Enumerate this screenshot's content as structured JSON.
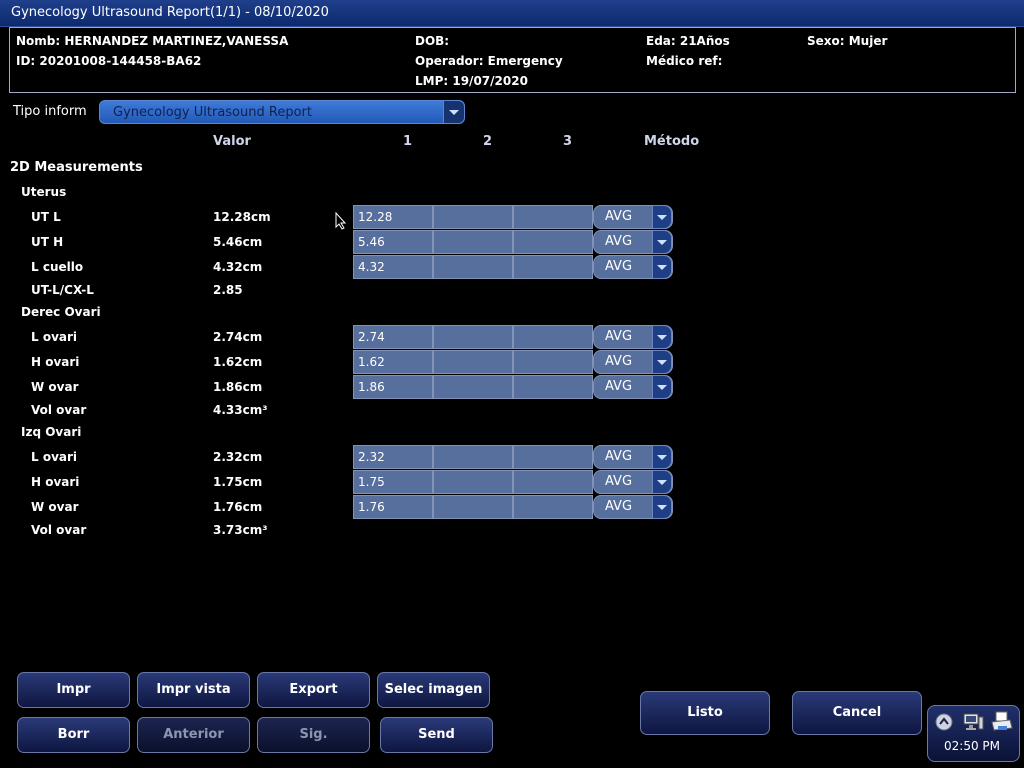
{
  "title": "Gynecology Ultrasound Report(1/1) - 08/10/2020",
  "patient": {
    "name": "Nomb: HERNANDEZ MARTINEZ,VANESSA",
    "id": "ID: 20201008-144458-BA62",
    "dob": "DOB:",
    "operator": "Operador: Emergency",
    "lmp": "LMP: 19/07/2020",
    "age": "Eda: 21Años",
    "ref_doctor": "Médico ref:",
    "sex": "Sexo: Mujer"
  },
  "report_type": {
    "label": "Tipo inform",
    "value": "Gynecology Ultrasound Report"
  },
  "columns": {
    "value": "Valor",
    "c1": "1",
    "c2": "2",
    "c3": "3",
    "method": "Método"
  },
  "section": "2D Measurements",
  "groups": {
    "uterus": {
      "name": "Uterus",
      "ut_l": {
        "label": "UT L",
        "value": "12.28cm",
        "m1": "12.28",
        "method": "AVG"
      },
      "ut_h": {
        "label": "UT H",
        "value": "5.46cm",
        "m1": "5.46",
        "method": "AVG"
      },
      "l_cuello": {
        "label": "L cuello",
        "value": "4.32cm",
        "m1": "4.32",
        "method": "AVG"
      },
      "ratio": {
        "label": "UT-L/CX-L",
        "value": "2.85"
      }
    },
    "right_ovary": {
      "name": "Derec Ovari",
      "l": {
        "label": "L ovari",
        "value": "2.74cm",
        "m1": "2.74",
        "method": "AVG"
      },
      "h": {
        "label": "H ovari",
        "value": "1.62cm",
        "m1": "1.62",
        "method": "AVG"
      },
      "w": {
        "label": "W ovar",
        "value": "1.86cm",
        "m1": "1.86",
        "method": "AVG"
      },
      "vol": {
        "label": "Vol ovar",
        "value": "4.33cm³"
      }
    },
    "left_ovary": {
      "name": "Izq Ovari",
      "l": {
        "label": "L ovari",
        "value": "2.32cm",
        "m1": "2.32",
        "method": "AVG"
      },
      "h": {
        "label": "H ovari",
        "value": "1.75cm",
        "m1": "1.75",
        "method": "AVG"
      },
      "w": {
        "label": "W ovar",
        "value": "1.76cm",
        "m1": "1.76",
        "method": "AVG"
      },
      "vol": {
        "label": "Vol ovar",
        "value": "3.73cm³"
      }
    }
  },
  "buttons": {
    "print": "Impr",
    "print_view": "Impr vista",
    "export": "Export",
    "select_image": "Selec imagen",
    "delete": "Borr",
    "previous": "Anterior",
    "next": "Sig.",
    "send": "Send",
    "done": "Listo",
    "cancel": "Cancel"
  },
  "tray": {
    "time": "02:50 PM"
  },
  "colors": {
    "title_bar": "#0d2a6e",
    "cell": "#566f9c",
    "select": "#2f6ad0"
  }
}
